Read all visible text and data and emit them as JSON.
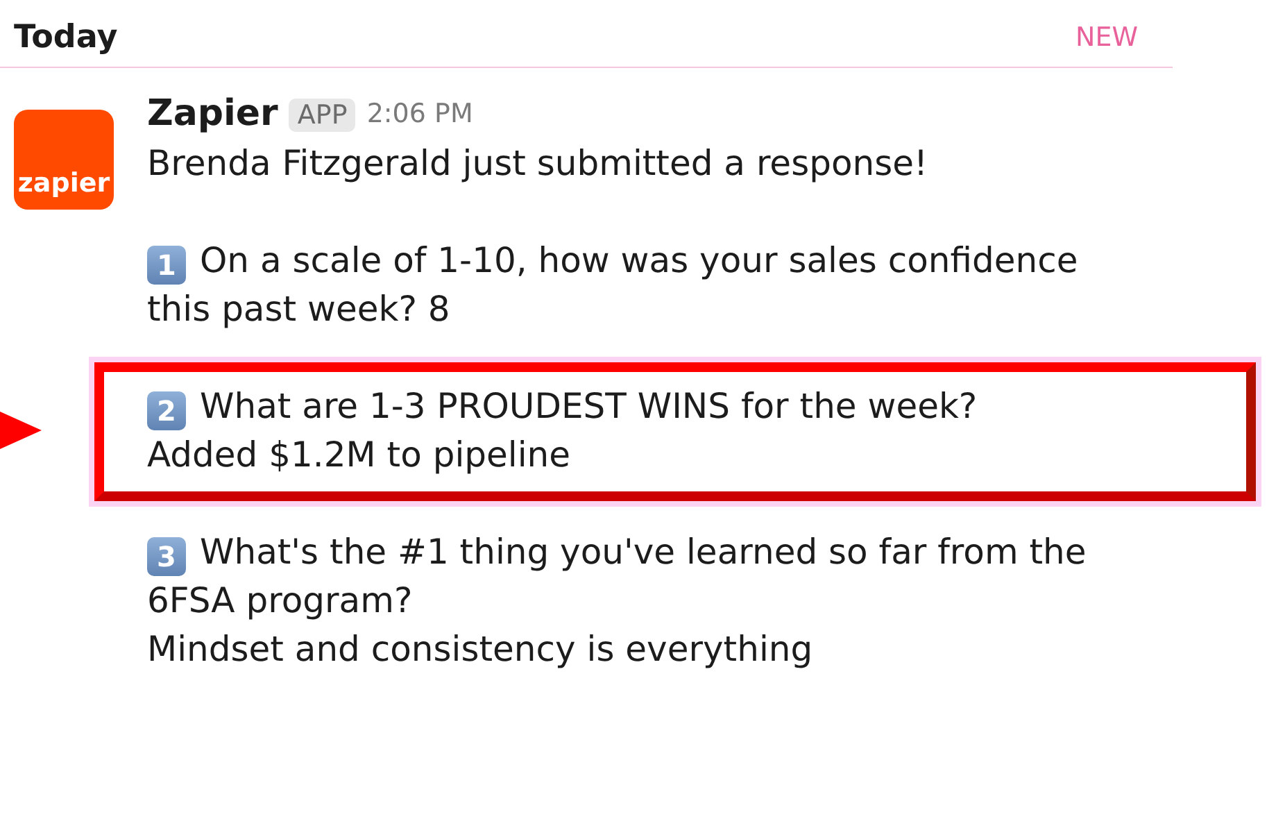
{
  "header": {
    "title": "Today",
    "badge": "NEW"
  },
  "message": {
    "sender": "Zapier",
    "avatar_text": "zapier",
    "tag": "APP",
    "time": "2:06 PM",
    "intro": "Brenda Fitzgerald just submitted a response!",
    "items": [
      {
        "number": "1",
        "question": "On a scale of 1-10, how was your sales confidence this past week?",
        "answer": "8",
        "kind": "inline",
        "highlighted": false
      },
      {
        "number": "2",
        "question": "What are 1-3 PROUDEST WINS for the week?",
        "answer": "Added $1.2M to pipeline",
        "kind": "block",
        "highlighted": true
      },
      {
        "number": "3",
        "question": "What's the #1 thing you've learned so far from the 6FSA program?",
        "answer": "Mindset and consistency is everything",
        "kind": "block",
        "highlighted": false
      }
    ]
  }
}
